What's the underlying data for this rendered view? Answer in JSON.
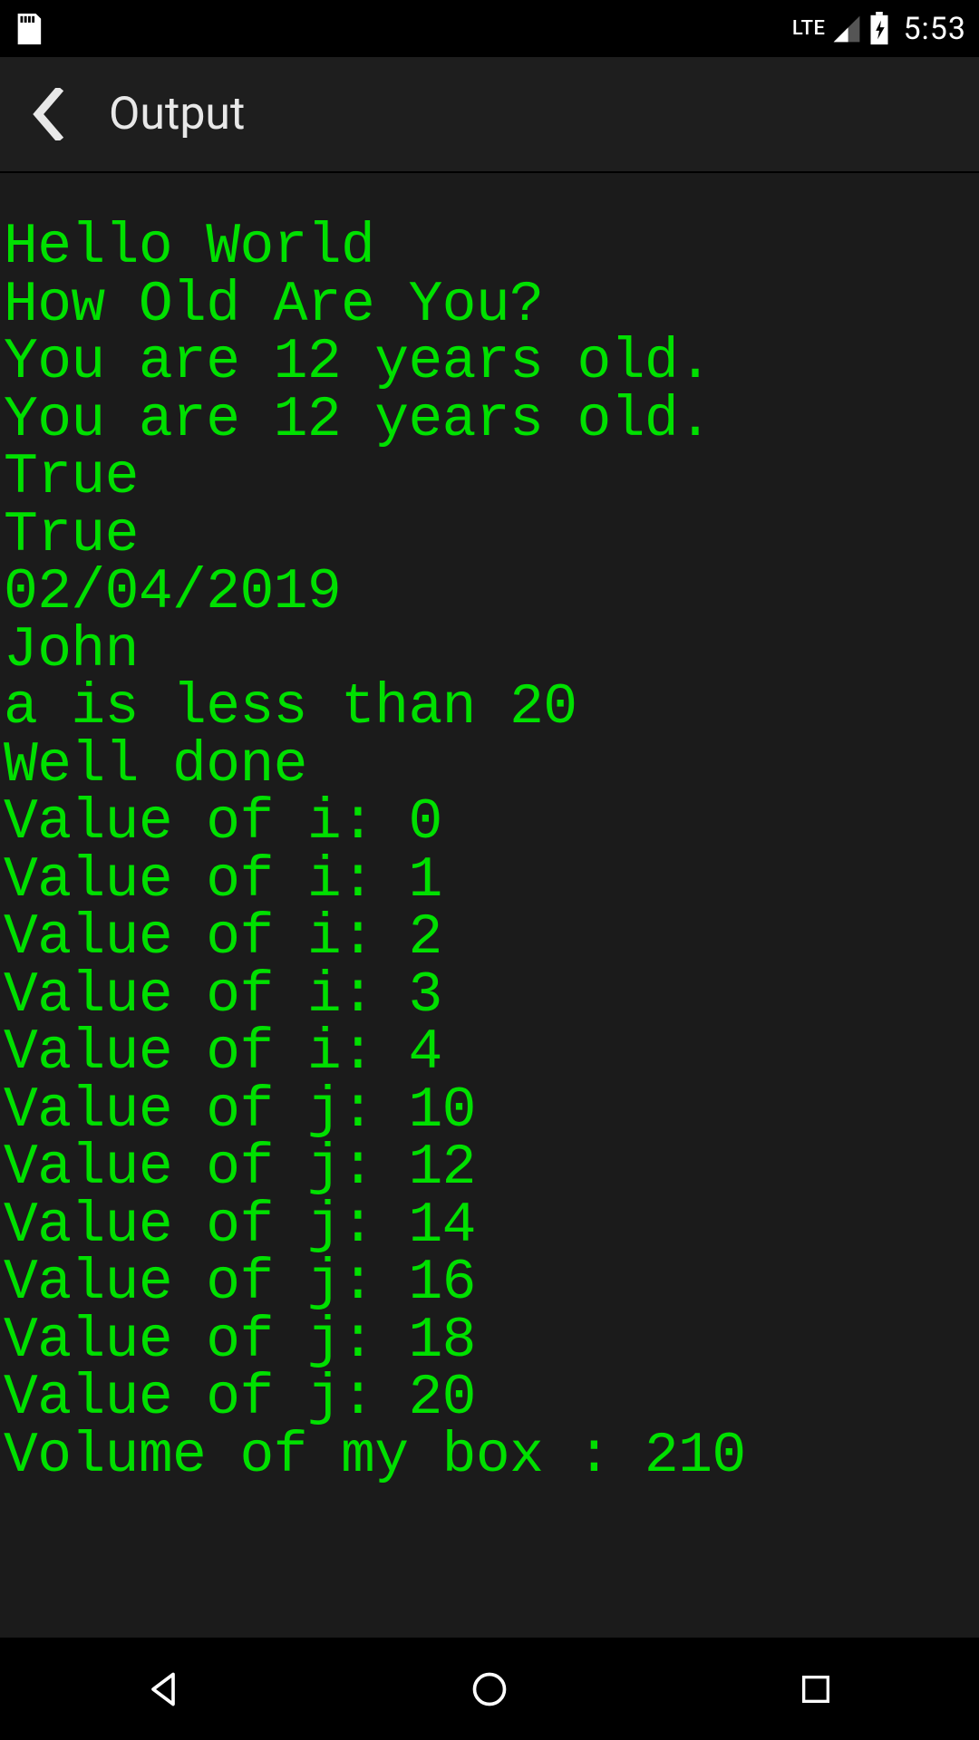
{
  "status": {
    "time": "5:53",
    "network": "LTE"
  },
  "header": {
    "title": "Output"
  },
  "console": {
    "lines": [
      "Hello World",
      "How Old Are You?",
      "You are 12 years old.",
      "You are 12 years old.",
      "True",
      "True",
      "02/04/2019",
      "John",
      "a is less than 20",
      "Well done",
      "Value of i: 0",
      "Value of i: 1",
      "Value of i: 2",
      "Value of i: 3",
      "Value of i: 4",
      "Value of j: 10",
      "Value of j: 12",
      "Value of j: 14",
      "Value of j: 16",
      "Value of j: 18",
      "Value of j: 20",
      "Volume of my box : 210"
    ]
  }
}
